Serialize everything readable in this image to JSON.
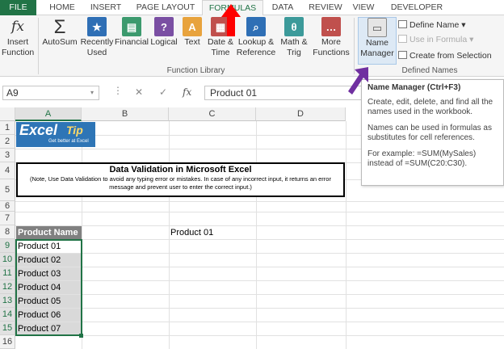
{
  "tabs": [
    "FILE",
    "HOME",
    "INSERT",
    "PAGE LAYOUT",
    "FORMULAS",
    "DATA",
    "REVIEW",
    "VIEW",
    "DEVELOPER"
  ],
  "ribbon": {
    "insert_function": {
      "icon": "fx",
      "l1": "Insert",
      "l2": "Function"
    },
    "autosum": {
      "l1": "AutoSum",
      "l2": ""
    },
    "recently_used": {
      "l1": "Recently",
      "l2": "Used"
    },
    "financial": {
      "l1": "Financial",
      "l2": ""
    },
    "logical": {
      "l1": "Logical",
      "l2": ""
    },
    "text": {
      "l1": "Text",
      "l2": ""
    },
    "date_time": {
      "l1": "Date &",
      "l2": "Time"
    },
    "lookup": {
      "l1": "Lookup &",
      "l2": "Reference"
    },
    "math": {
      "l1": "Math &",
      "l2": "Trig"
    },
    "more": {
      "l1": "More",
      "l2": "Functions"
    },
    "function_library": "Function Library",
    "name_manager": {
      "l1": "Name",
      "l2": "Manager"
    },
    "define_name": "Define Name",
    "use_in_formula": "Use in Formula",
    "create_from_selection": "Create from Selection",
    "defined_names": "Defined Names"
  },
  "formula_bar": {
    "name_box": "A9",
    "fx": "fx",
    "value": "Product 01"
  },
  "columns": [
    "A",
    "B",
    "C",
    "D"
  ],
  "rows": [
    "1",
    "2",
    "3",
    "4",
    "5",
    "6",
    "7",
    "8",
    "9",
    "10",
    "11",
    "12",
    "13",
    "14",
    "15",
    "16"
  ],
  "logo": {
    "word1": "Excel",
    "word2": "Tip",
    "tagline": "Get better at Excel"
  },
  "box": {
    "title": "Data Validation in Microsoft Excel",
    "note": "(Note, Use Data Validation to avoid any typing error or mistakes. In case of any incorrect input, it returns an error message and prevent user to enter the correct input.)"
  },
  "table": {
    "header": "Product Name",
    "items": [
      "Product 01",
      "Product 02",
      "Product 03",
      "Product 04",
      "Product 05",
      "Product 06",
      "Product 07"
    ]
  },
  "c8_value": "Product 01",
  "tooltip": {
    "title": "Name Manager (Ctrl+F3)",
    "p1": "Create, edit, delete, and find all the names used in the workbook.",
    "p2": "Names can be used in formulas as substitutes for cell references.",
    "p3": "For example: =SUM(MySales) instead of =SUM(C20:C30)."
  },
  "colors": {
    "excel_green": "#217346",
    "header_fill": "#808080",
    "arrow_red": "#ff0000",
    "arrow_purple": "#7030a0"
  }
}
